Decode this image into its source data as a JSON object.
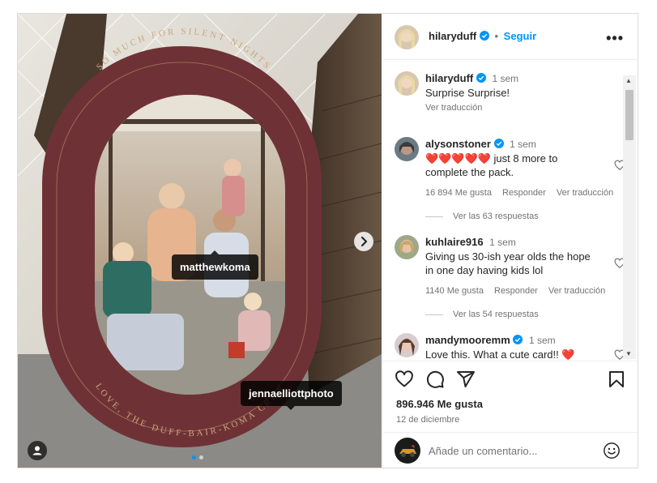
{
  "post": {
    "author": "hilaryduff",
    "follow_label": "Seguir",
    "more_label": "•••"
  },
  "media": {
    "card_text_top": "SO MUCH FOR SILENT NIGHTS",
    "card_text_bottom": "LOVE, THE DUFF-BAIR-KOMA CREW",
    "tags": [
      "matthewkoma",
      "jennaelliottphoto"
    ]
  },
  "caption": {
    "username": "hilaryduff",
    "time": "1 sem",
    "text": "Surprise Surprise!",
    "translate": "Ver traducción"
  },
  "comments": [
    {
      "username": "alysonstoner",
      "time": "1 sem",
      "text": "❤️❤️❤️❤️❤️ just 8 more to complete the pack.",
      "likes": "16 894 Me gusta",
      "reply": "Responder",
      "translate": "Ver traducción",
      "replies": "Ver las 63 respuestas"
    },
    {
      "username": "kuhlaire916",
      "time": "1 sem",
      "text": "Giving us 30-ish year olds the hope in one day having kids lol",
      "likes": "1140 Me gusta",
      "reply": "Responder",
      "translate": "Ver traducción",
      "replies": "Ver las 54 respuestas"
    },
    {
      "username": "mandymooremm",
      "time": "1 sem",
      "text": "Love this. What a cute card!! ❤️"
    }
  ],
  "stats": {
    "likes": "896.946 Me gusta",
    "date": "12 de diciembre"
  },
  "composer": {
    "placeholder": "Añade un comentario..."
  },
  "colors": {
    "accent": "#0095f6",
    "verified": "#0095f6",
    "card": "#6e3236",
    "heart": "#ed1c24"
  },
  "icons": [
    "verified-icon",
    "more-icon",
    "heart-icon",
    "comment-icon",
    "share-icon",
    "bookmark-icon",
    "emoji-icon",
    "chevron-right-icon",
    "user-tag-icon"
  ]
}
